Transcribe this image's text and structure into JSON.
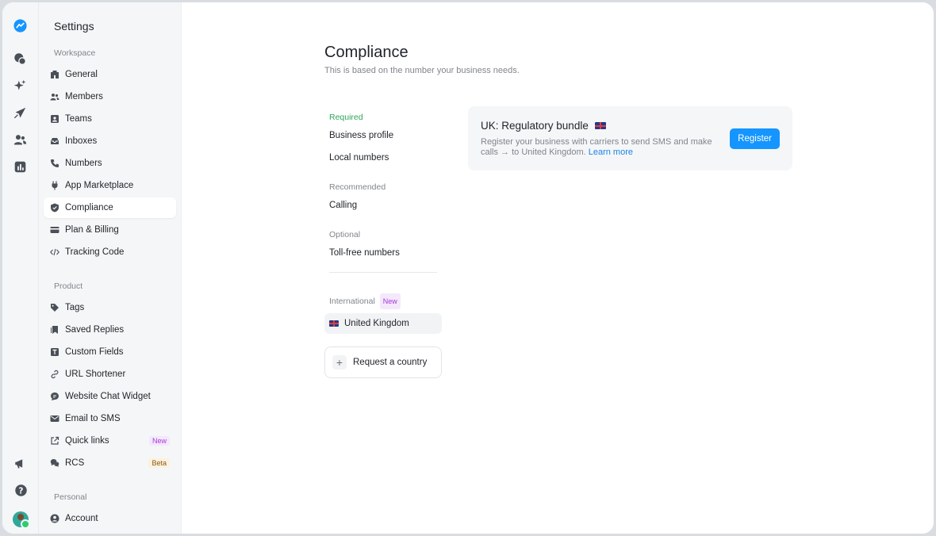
{
  "rail": {
    "icons": [
      "logo-icon",
      "chat-icon",
      "sparkle-icon",
      "campaign-icon",
      "contacts-icon",
      "analytics-icon",
      "megaphone-icon",
      "help-icon"
    ]
  },
  "sidebar": {
    "title": "Settings",
    "workspace_label": "Workspace",
    "workspace_items": [
      {
        "label": "General",
        "icon": "building-icon"
      },
      {
        "label": "Members",
        "icon": "members-icon"
      },
      {
        "label": "Teams",
        "icon": "teams-icon"
      },
      {
        "label": "Inboxes",
        "icon": "inbox-icon"
      },
      {
        "label": "Numbers",
        "icon": "phone-icon"
      },
      {
        "label": "App Marketplace",
        "icon": "plug-icon"
      },
      {
        "label": "Compliance",
        "icon": "shield-icon",
        "active": true
      },
      {
        "label": "Plan & Billing",
        "icon": "card-icon"
      },
      {
        "label": "Tracking Code",
        "icon": "code-icon"
      }
    ],
    "product_label": "Product",
    "product_items": [
      {
        "label": "Tags",
        "icon": "tag-icon"
      },
      {
        "label": "Saved Replies",
        "icon": "bookmark-icon"
      },
      {
        "label": "Custom Fields",
        "icon": "text-field-icon"
      },
      {
        "label": "URL Shortener",
        "icon": "link-icon"
      },
      {
        "label": "Website Chat Widget",
        "icon": "chat-bubble-icon"
      },
      {
        "label": "Email to SMS",
        "icon": "mail-icon"
      },
      {
        "label": "Quick links",
        "icon": "external-link-icon",
        "badge": "New"
      },
      {
        "label": "RCS",
        "icon": "rcs-icon",
        "badge": "Beta"
      }
    ],
    "personal_label": "Personal",
    "personal_items": [
      {
        "label": "Account",
        "icon": "account-icon"
      }
    ]
  },
  "main": {
    "title": "Compliance",
    "subtitle": "This is based on the number your business needs.",
    "subnav": {
      "required_label": "Required",
      "required_items": [
        "Business profile",
        "Local numbers"
      ],
      "recommended_label": "Recommended",
      "recommended_items": [
        "Calling"
      ],
      "optional_label": "Optional",
      "optional_items": [
        "Toll-free numbers"
      ],
      "international_label": "International",
      "international_badge": "New",
      "country": "United Kingdom",
      "request_label": "Request a country"
    },
    "card": {
      "title": "UK: Regulatory bundle",
      "description": "Register your business with carriers to send SMS and make calls → to United Kingdom.",
      "link": "Learn more",
      "button": "Register"
    }
  },
  "colors": {
    "accent": "#1495ff",
    "required": "#2ea55a",
    "new_badge": "#a63ad6",
    "beta_badge": "#8a5a12"
  }
}
